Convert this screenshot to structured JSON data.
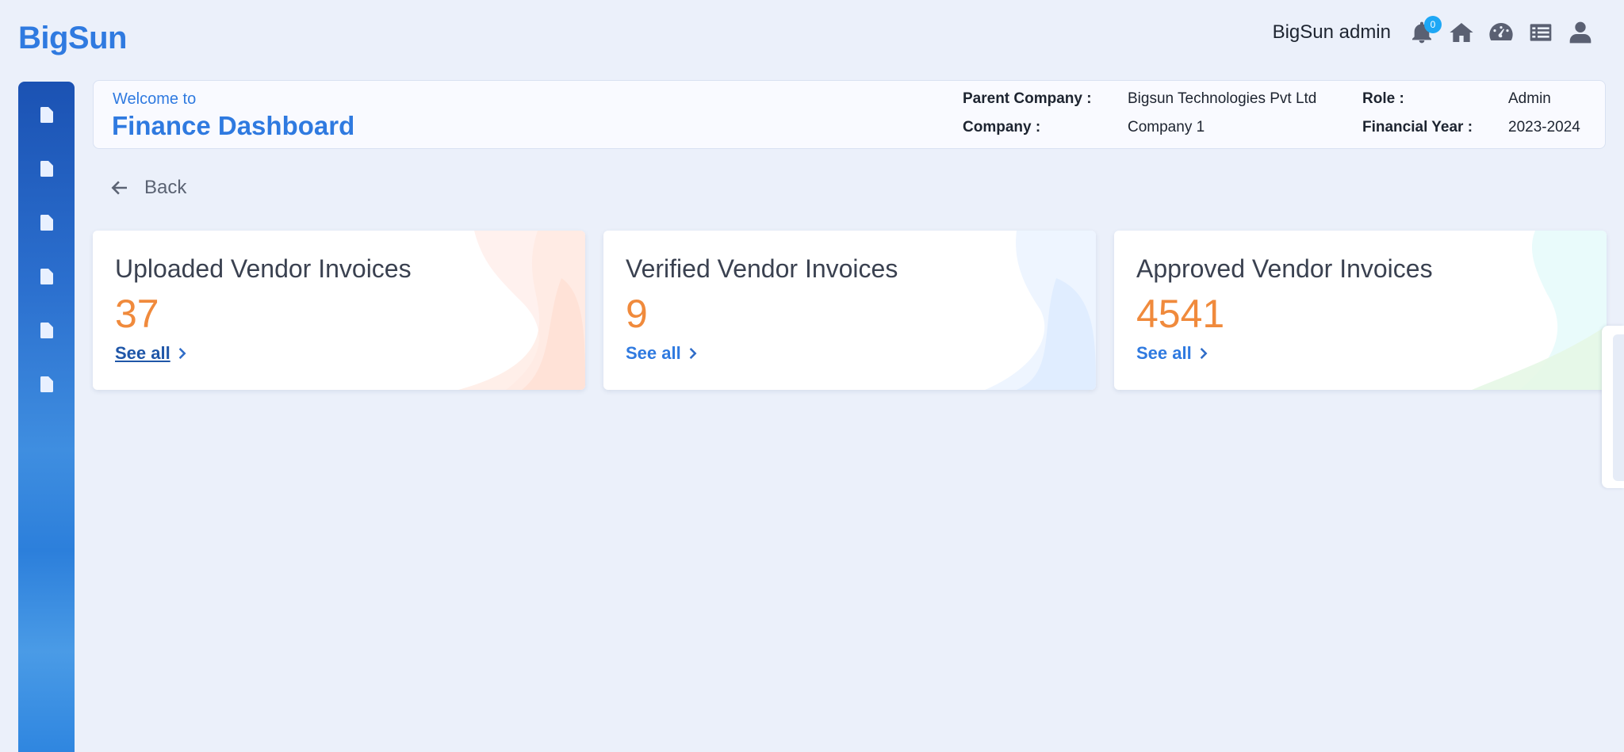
{
  "app": {
    "logo": "BigSun"
  },
  "topbar": {
    "user_name": "BigSun admin",
    "notification_count": "0",
    "icons": [
      "bell-icon",
      "home-icon",
      "dashboard-gauge-icon",
      "list-icon",
      "user-icon"
    ]
  },
  "sidebar": {
    "items": [
      {
        "icon": "document-icon"
      },
      {
        "icon": "document-icon"
      },
      {
        "icon": "document-icon"
      },
      {
        "icon": "document-icon"
      },
      {
        "icon": "document-icon"
      },
      {
        "icon": "document-icon"
      }
    ]
  },
  "header": {
    "welcome": "Welcome to",
    "title": "Finance Dashboard",
    "parent_company_label": "Parent Company :",
    "parent_company_value": "Bigsun Technologies Pvt Ltd",
    "role_label": "Role :",
    "role_value": "Admin",
    "company_label": "Company :",
    "company_value": "Company 1",
    "financial_year_label": "Financial Year :",
    "financial_year_value": "2023-2024"
  },
  "back": {
    "label": "Back"
  },
  "cards": [
    {
      "title": "Uploaded Vendor Invoices",
      "value": "37",
      "link": "See all"
    },
    {
      "title": "Verified Vendor Invoices",
      "value": "9",
      "link": "See all"
    },
    {
      "title": "Approved Vendor Invoices",
      "value": "4541",
      "link": "See all"
    }
  ],
  "colors": {
    "accent": "#2f7ae0",
    "value": "#f08a3c",
    "background": "#ebf0fa"
  }
}
